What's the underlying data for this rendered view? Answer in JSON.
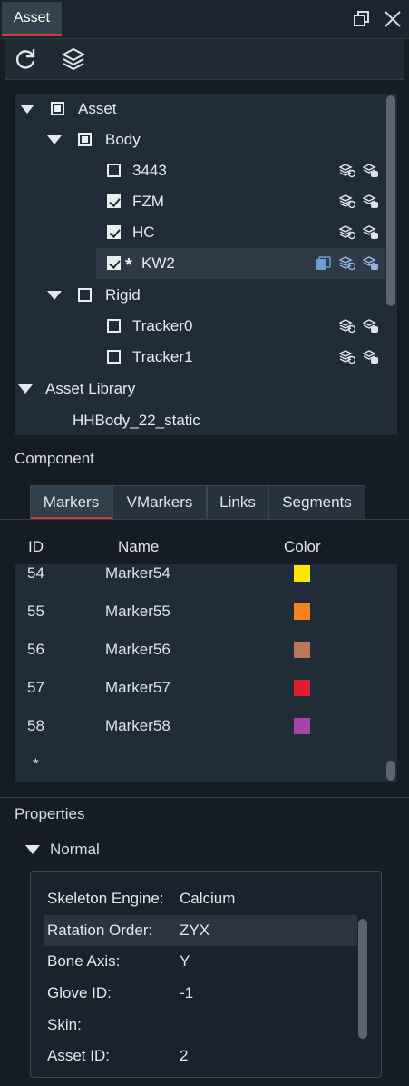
{
  "window": {
    "tab_title": "Asset"
  },
  "toolbar": {
    "icons": [
      "refresh-icon",
      "layers-icon"
    ]
  },
  "tree": {
    "rows": [
      {
        "label": "Asset"
      },
      {
        "label": "Body"
      },
      {
        "label": "3443"
      },
      {
        "label": "FZM"
      },
      {
        "label": "HC"
      },
      {
        "label": "KW2",
        "modified_mark": "*"
      },
      {
        "label": "Rigid"
      },
      {
        "label": "Tracker0"
      },
      {
        "label": "Tracker1"
      },
      {
        "label": "Asset Library"
      },
      {
        "label": "HHBody_22_static"
      }
    ]
  },
  "component": {
    "title": "Component",
    "tabs": [
      "Markers",
      "VMarkers",
      "Links",
      "Segments"
    ],
    "active_tab": "Markers",
    "columns": [
      "ID",
      "Name",
      "Color"
    ],
    "markers": [
      {
        "id": "54",
        "name": "Marker54",
        "color": "#ffe600"
      },
      {
        "id": "55",
        "name": "Marker55",
        "color": "#f58220"
      },
      {
        "id": "56",
        "name": "Marker56",
        "color": "#b9785a"
      },
      {
        "id": "57",
        "name": "Marker57",
        "color": "#d9212c"
      },
      {
        "id": "58",
        "name": "Marker58",
        "color": "#a346a8"
      }
    ],
    "new_row": "*"
  },
  "properties": {
    "title": "Properties",
    "group": "Normal",
    "rows": [
      {
        "key": "Skeleton Engine:",
        "value": "Calcium"
      },
      {
        "key": "Ratation Order:",
        "value": "ZYX"
      },
      {
        "key": "Bone Axis:",
        "value": "Y"
      },
      {
        "key": "Glove ID:",
        "value": "-1"
      },
      {
        "key": "Skin:",
        "value": ""
      },
      {
        "key": "Asset ID:",
        "value": "2"
      }
    ]
  },
  "colors": {
    "accent": "#d23a3a",
    "panel": "#202c37",
    "selected": "#2e3a47"
  }
}
